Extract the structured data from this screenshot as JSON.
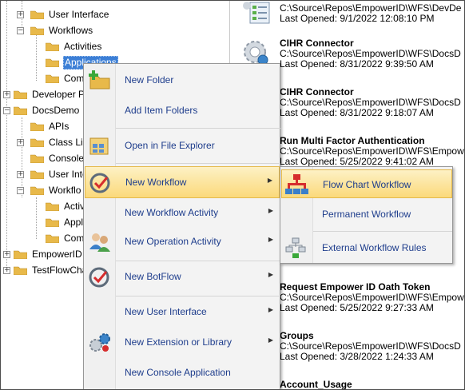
{
  "tree": {
    "items": [
      {
        "label": "User Interface",
        "level": 2,
        "expander": "+"
      },
      {
        "label": "Workflows",
        "level": 1,
        "expander": "-"
      },
      {
        "label": "Activities",
        "level": 3,
        "expander": ""
      },
      {
        "label": "Applications",
        "level": 3,
        "expander": "",
        "selected": true
      },
      {
        "label": "Com",
        "level": 3,
        "expander": ""
      },
      {
        "label": "Developer P",
        "level": 0,
        "expander": "+"
      },
      {
        "label": "DocsDemo",
        "level": 0,
        "expander": "-"
      },
      {
        "label": "APIs",
        "level": 2,
        "expander": ""
      },
      {
        "label": "Class Lib",
        "level": 1,
        "expander": "+"
      },
      {
        "label": "Console",
        "level": 2,
        "expander": ""
      },
      {
        "label": "User Inte",
        "level": 1,
        "expander": "+"
      },
      {
        "label": "Workflo",
        "level": 1,
        "expander": "-"
      },
      {
        "label": "Activ",
        "level": 3,
        "expander": ""
      },
      {
        "label": "Appl",
        "level": 3,
        "expander": ""
      },
      {
        "label": "Com",
        "level": 3,
        "expander": ""
      },
      {
        "label": "EmpowerID",
        "level": 0,
        "expander": "+"
      },
      {
        "label": "TestFlowCha",
        "level": 0,
        "expander": "+"
      }
    ]
  },
  "recent": {
    "items": [
      {
        "title": "",
        "path": "C:\\Source\\Repos\\EmpowerID\\WFS\\DevDe",
        "date": "Last Opened: 9/1/2022 12:08:10 PM",
        "icon": "checklist-icon"
      },
      {
        "title": "CIHR Connector",
        "path": "C:\\Source\\Repos\\EmpowerID\\WFS\\DocsD",
        "date": "Last Opened: 8/31/2022 9:39:50 AM",
        "icon": "gear-icon"
      },
      {
        "title": "CIHR Connector",
        "path": "C:\\Source\\Repos\\EmpowerID\\WFS\\DocsD",
        "date": "Last Opened: 8/31/2022 9:18:07 AM",
        "icon": ""
      },
      {
        "title": "Run Multi Factor Authentication",
        "path": "C:\\Source\\Repos\\EmpowerID\\WFS\\Empow",
        "date": "Last Opened: 5/25/2022 9:41:02 AM",
        "icon": ""
      },
      {
        "title": "Request Empower ID Oath Token",
        "path": "C:\\Source\\Repos\\EmpowerID\\WFS\\Empow",
        "date": "Last Opened: 5/25/2022 9:27:33 AM",
        "icon": ""
      },
      {
        "title": "Groups",
        "path": "C:\\Source\\Repos\\EmpowerID\\WFS\\DocsD",
        "date": "Last Opened: 3/28/2022 1:24:33 AM",
        "icon": ""
      },
      {
        "title": "Account_Usage",
        "path": "",
        "date": "",
        "icon": ""
      }
    ]
  },
  "context_menu": {
    "items": [
      {
        "label": "New Folder",
        "icon": "new-folder-icon",
        "submenu": false
      },
      {
        "label": "Add Item Folders",
        "icon": "",
        "submenu": false
      },
      {
        "label": "Open in File Explorer",
        "icon": "file-explorer-icon",
        "submenu": false
      },
      {
        "label": "New Workflow",
        "icon": "workflow-check-icon",
        "submenu": true,
        "highlighted": true
      },
      {
        "label": "New Workflow Activity",
        "icon": "",
        "submenu": true
      },
      {
        "label": "New Operation Activity",
        "icon": "users-icon",
        "submenu": true
      },
      {
        "label": "New BotFlow",
        "icon": "botflow-icon",
        "submenu": true
      },
      {
        "label": "New User Interface",
        "icon": "",
        "submenu": true
      },
      {
        "label": "New Extension or Library",
        "icon": "gears-icon",
        "submenu": true
      },
      {
        "label": "New Console Application",
        "icon": "",
        "submenu": false
      }
    ],
    "arrow_glyph": "▶"
  },
  "submenu": {
    "items": [
      {
        "label": "Flow Chart Workflow",
        "icon": "flowchart-icon",
        "highlighted": true
      },
      {
        "label": "Permanent Workflow",
        "icon": ""
      },
      {
        "label": "External Workflow Rules",
        "icon": "external-rules-icon"
      }
    ]
  },
  "colors": {
    "menu_text": "#1e3d8c",
    "highlight_top": "#fdf1c5",
    "highlight_bottom": "#fbd97a",
    "selection": "#3c7fd6"
  }
}
